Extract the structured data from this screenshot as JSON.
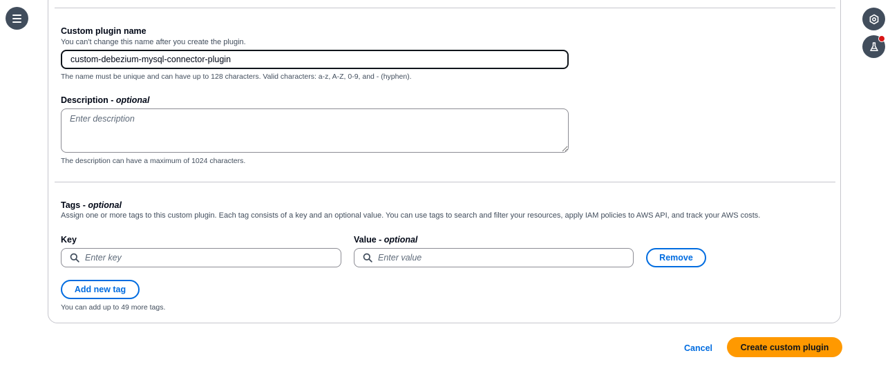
{
  "plugin_name": {
    "label": "Custom plugin name",
    "description": "You can't change this name after you create the plugin.",
    "value": "custom-debezium-mysql-connector-plugin",
    "constraint": "The name must be unique and can have up to 128 characters. Valid characters: a-z, A-Z, 0-9, and - (hyphen)."
  },
  "description_field": {
    "label": "Description",
    "optional": "optional",
    "placeholder": "Enter description",
    "constraint": "The description can have a maximum of 1024 characters."
  },
  "tags": {
    "label": "Tags",
    "optional": "optional",
    "description": "Assign one or more tags to this custom plugin. Each tag consists of a key and an optional value. You can use tags to search and filter your resources, apply IAM policies to AWS API, and track your AWS costs.",
    "key_label": "Key",
    "value_label": "Value",
    "value_optional": "optional",
    "key_placeholder": "Enter key",
    "value_placeholder": "Enter value",
    "remove_label": "Remove",
    "add_label": "Add new tag",
    "limit_text": "You can add up to 49 more tags."
  },
  "actions": {
    "cancel_label": "Cancel",
    "create_label": "Create custom plugin"
  },
  "icons": {
    "menu": "hamburger-menu-icon",
    "rail_top": "hexagon-settings-icon",
    "rail_bottom": "flask-icon",
    "search": "search-icon"
  },
  "colors": {
    "accent": "#006ce0",
    "primary_button": "#ff9900",
    "notification": "#d91515",
    "rail": "#414d5c"
  }
}
